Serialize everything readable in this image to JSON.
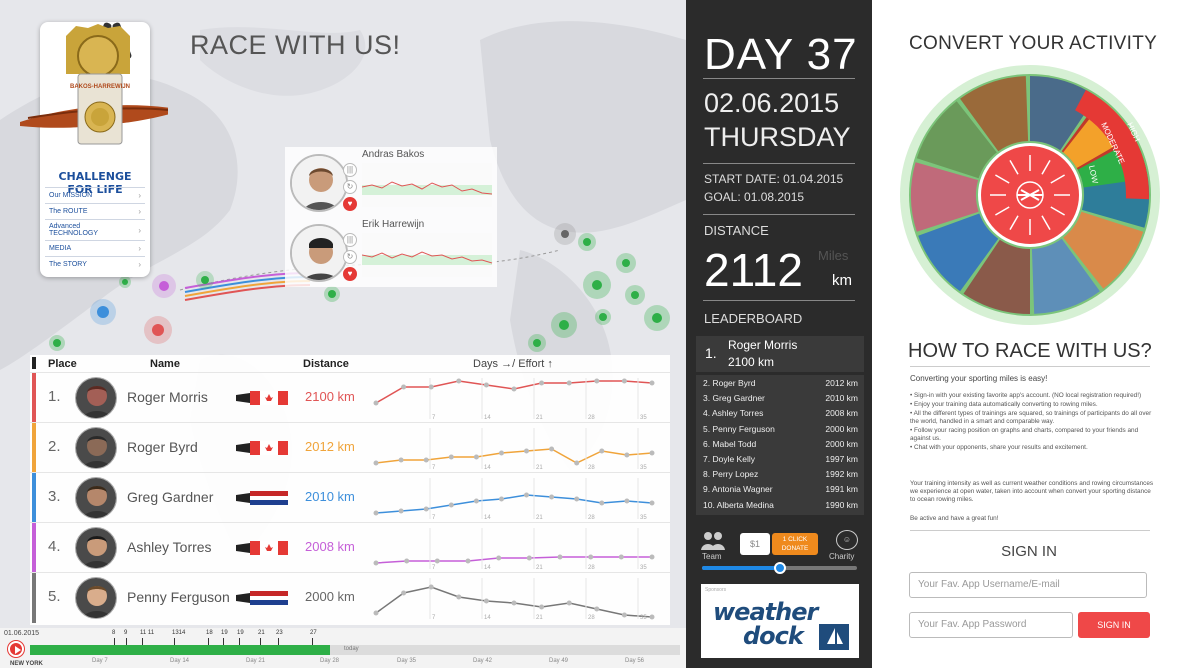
{
  "left": {
    "title": "RACE WITH US!",
    "logo": {
      "badge_text": "BAKOS-HARREWIJN",
      "challenge": "CHALLENGE FOR LIFE",
      "menu": [
        "Our MISSION",
        "The ROUTE",
        "Advanced TECHNOLOGY",
        "MEDIA",
        "The STORY"
      ]
    },
    "racer_popup": [
      {
        "name": "Andras Bakos"
      },
      {
        "name": "Erik Harrewijn"
      }
    ],
    "table": {
      "headers": {
        "place": "Place",
        "name": "Name",
        "distance": "Distance",
        "days_effort": "Days →/ Effort ↑"
      },
      "rows": [
        {
          "place": "1.",
          "name": "Roger Morris",
          "distance": "2100 km",
          "flag": "canada",
          "color": "#e05555"
        },
        {
          "place": "2.",
          "name": "Roger Byrd",
          "distance": "2012 km",
          "flag": "canada",
          "color": "#f0a43a"
        },
        {
          "place": "3.",
          "name": "Greg Gardner",
          "distance": "2010 km",
          "flag": "netherlands",
          "color": "#3d8fdb"
        },
        {
          "place": "4.",
          "name": "Ashley Torres",
          "distance": "2008 km",
          "flag": "canada",
          "color": "#c55fd8"
        },
        {
          "place": "5.",
          "name": "Penny Ferguson",
          "distance": "2000 km",
          "flag": "netherlands",
          "color": "#777777"
        }
      ],
      "axis_ticks": [
        "7",
        "14",
        "21",
        "28",
        "35"
      ]
    },
    "timeline": {
      "start_date": "01.06.2015",
      "location": "NEW YORK",
      "today": "today",
      "ticks": [
        "8",
        "9",
        "11 11",
        "1314",
        "18",
        "19",
        "19",
        "21",
        "23",
        "27"
      ],
      "days": [
        "Day 7",
        "Day 14",
        "Day 21",
        "Day 28",
        "Day 35",
        "Day 42",
        "Day 49",
        "Day 56"
      ]
    }
  },
  "mid": {
    "day": "DAY 37",
    "date": "02.06.2015",
    "weekday": "THURSDAY",
    "start_date": "START DATE: 01.04.2015",
    "goal": "GOAL: 01.08.2015",
    "distance_label": "DISTANCE",
    "distance_value": "2112",
    "distance_miles": "Miles",
    "distance_km": "km",
    "leaderboard_label": "LEADERBOARD",
    "leader": {
      "num": "1.",
      "name": "Roger Morris",
      "dist": "2100 km"
    },
    "leaderboard": [
      {
        "name": "2. Roger Byrd",
        "dist": "2012 km"
      },
      {
        "name": "3. Greg Gardner",
        "dist": "2010 km"
      },
      {
        "name": "4. Ashley Torres",
        "dist": "2008 km"
      },
      {
        "name": "5. Penny Ferguson",
        "dist": "2000 km"
      },
      {
        "name": "6. Mabel Todd",
        "dist": "2000 km"
      },
      {
        "name": "7. Doyle Kelly",
        "dist": "1997 km"
      },
      {
        "name": "8. Perry Lopez",
        "dist": "1992 km"
      },
      {
        "name": "9. Antonia Wagner",
        "dist": "1991 km"
      },
      {
        "name": "10. Alberta Medina",
        "dist": "1990 km"
      }
    ],
    "team_label": "Team",
    "dollar": "$1",
    "donate_line1": "1 CLICK",
    "donate_line2": "DONATE",
    "charity_label": "Charity",
    "slider_fraction": 0.5,
    "sponsor_label": "Sponsors",
    "sponsor_word1": "weather",
    "sponsor_word2": "dock"
  },
  "right": {
    "convert_title": "CONVERT YOUR ACTIVITY",
    "intensity": [
      "LOW",
      "MODERATE",
      "HIGH"
    ],
    "howto_title": "HOW TO RACE WITH US?",
    "howto_lead": "Converting your sporting miles is easy!",
    "howto_bullets": [
      "• Sign-in with your existing favorite app's account. (NO local registration required!)",
      "• Enjoy your training data automatically converting to rowing miles.",
      "• All the different types of trainings are squared, so trainings of participants do all over the world, handled in a smart and comparable way.",
      "• Follow your racing position on graphs and charts, compared to your friends and against us.",
      "• Chat with your opponents, share your results and excitement."
    ],
    "howto_p2": "Your training intensity as well as current weather conditions and rowing circumstances we experience at open water, taken into account when convert your sporting distance to ocean rowing miles.",
    "howto_p3": "Be active and have a great fun!",
    "signin_title": "SIGN IN",
    "username_placeholder": "Your Fav. App Username/E-mail",
    "password_placeholder": "Your Fav. App Password",
    "signin_button": "SIGN IN"
  }
}
